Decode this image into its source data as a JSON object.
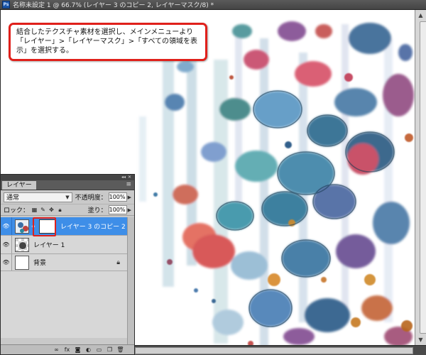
{
  "document": {
    "app_badge": "Ps",
    "title": "名称未設定 1 @ 66.7% (レイヤー 3 のコピー 2, レイヤーマスク/8) *"
  },
  "callout": {
    "text": "結合したテクスチャ素材を選択し、メインメニューより「レイヤー」>「レイヤーマスク」>「すべての領域を表示」を選択する。"
  },
  "layers_panel": {
    "tab_label": "レイヤー",
    "blend_mode": "通常",
    "opacity_label": "不透明度：",
    "opacity_value": "100%",
    "lock_label": "ロック：",
    "fill_label": "塗り：",
    "fill_value": "100%",
    "layers": [
      {
        "name": "レイヤー 3 のコピー 2",
        "visible": true,
        "selected": true,
        "has_mask": true
      },
      {
        "name": "レイヤー 1",
        "visible": true,
        "selected": false,
        "has_mask": false
      },
      {
        "name": "背景",
        "visible": true,
        "selected": false,
        "locked": true
      }
    ],
    "footer_icons": [
      "link-icon",
      "fx-icon",
      "add-mask-icon",
      "adjustment-icon",
      "group-icon",
      "new-layer-icon",
      "trash-icon"
    ]
  },
  "colors": {
    "highlight_red": "#e0201b",
    "selected_layer_blue": "#3e8ee8"
  }
}
